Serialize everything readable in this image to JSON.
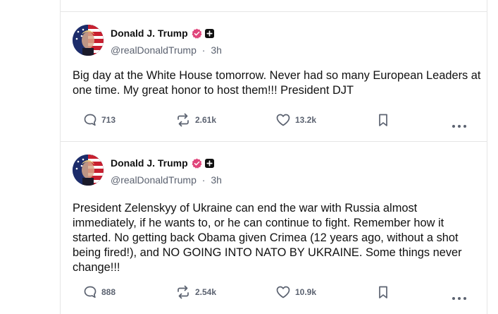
{
  "posts": [
    {
      "author": "Donald J. Trump",
      "handle": "@realDonaldTrump",
      "separator": "·",
      "time": "3h",
      "text": "Big day at the White House tomorrow. Never had so many European Leaders at one time. My great honor to host them!!! President DJT",
      "replies": "713",
      "reposts": "2.61k",
      "likes": "13.2k"
    },
    {
      "author": "Donald J. Trump",
      "handle": "@realDonaldTrump",
      "separator": "·",
      "time": "3h",
      "text": "President Zelenskyy of Ukraine can end the war with Russia almost immediately, if he wants to, or he can continue to fight. Remember how it started. No getting back Obama given Crimea (12 years ago, without a shot being fired!), and NO GOING INTO NATO BY UKRAINE. Some things never change!!!",
      "replies": "888",
      "reposts": "2.54k",
      "likes": "10.9k"
    }
  ],
  "icons": {
    "reply": "speech-bubble-icon",
    "repost": "repost-arrows-icon",
    "like": "heart-icon",
    "bookmark": "bookmark-icon",
    "more": "more-dots-icon",
    "verified": "verified-badge-icon",
    "plus": "plus-badge-icon"
  },
  "colors": {
    "verified": "#e0457b",
    "text": "#111111",
    "muted": "#5b6270",
    "divider": "#e6e6e6"
  }
}
